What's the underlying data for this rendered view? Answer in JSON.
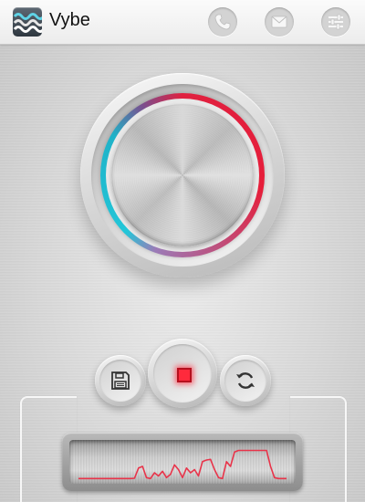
{
  "app": {
    "title": "Vybe",
    "logo_icon": "wave-logo-icon"
  },
  "actions": [
    {
      "name": "phone-icon"
    },
    {
      "name": "mail-icon"
    },
    {
      "name": "settings-sliders-icon"
    }
  ],
  "controls": {
    "left": "save-icon",
    "center": "record-icon",
    "right": "sync-icon"
  },
  "colors": {
    "ring_red": "#e61e3a",
    "ring_cyan": "#22c6d8",
    "record_led": "#ff2a3c",
    "waveform": "#e8344a"
  },
  "waveform": {
    "levels": [
      0.02,
      0.02,
      0.02,
      0.02,
      0.02,
      0.02,
      0.02,
      0.02,
      0.02,
      0.02,
      0.02,
      0.02,
      0.02,
      0.02,
      0.03,
      0.35,
      0.4,
      0.05,
      0.02,
      0.2,
      0.1,
      0.25,
      0.05,
      0.15,
      0.45,
      0.3,
      0.05,
      0.35,
      0.2,
      0.3,
      0.1,
      0.55,
      0.6,
      0.62,
      0.3,
      0.05,
      0.02,
      0.55,
      0.4,
      0.85,
      0.9,
      0.9,
      0.9,
      0.9,
      0.9,
      0.9,
      0.9,
      0.9,
      0.4,
      0.05,
      0.02,
      0.02,
      0.02
    ]
  }
}
